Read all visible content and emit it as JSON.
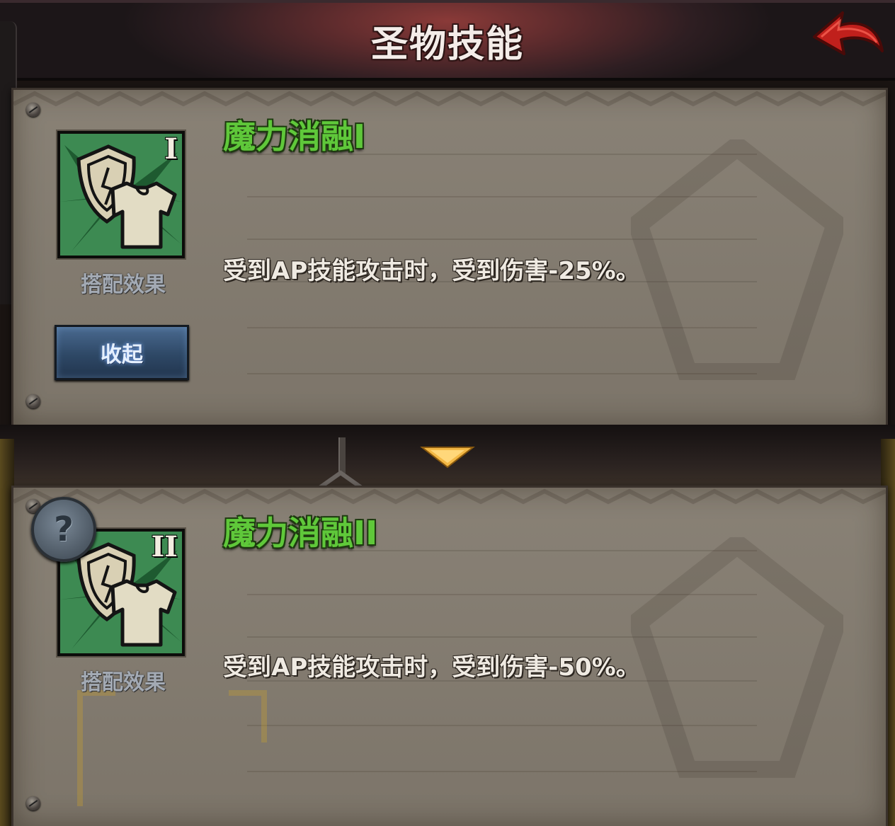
{
  "header": {
    "title": "圣物技能",
    "back_icon": "back-arrow-icon"
  },
  "skills": [
    {
      "name": "魔力消融I",
      "tier": "I",
      "combo_label": "搭配效果",
      "description": "受到AP技能攻击时，受到伤害-25%。",
      "icon": "shield-shirt-icon"
    },
    {
      "name": "魔力消融II",
      "tier": "II",
      "combo_label": "搭配效果",
      "description": "受到AP技能攻击时，受到伤害-50%。",
      "icon": "shield-shirt-icon"
    }
  ],
  "collapse_button": {
    "label": "收起"
  },
  "help_button": {
    "label": "?",
    "icon": "question-mark-icon"
  },
  "colors": {
    "skill_name": "#5fc83a",
    "panel_bg": "#847c70",
    "header_accent": "#8a3a38",
    "back_arrow": "#c0201c",
    "expand_arrow": "#f3b845",
    "collapse_button": "#2e4866"
  }
}
